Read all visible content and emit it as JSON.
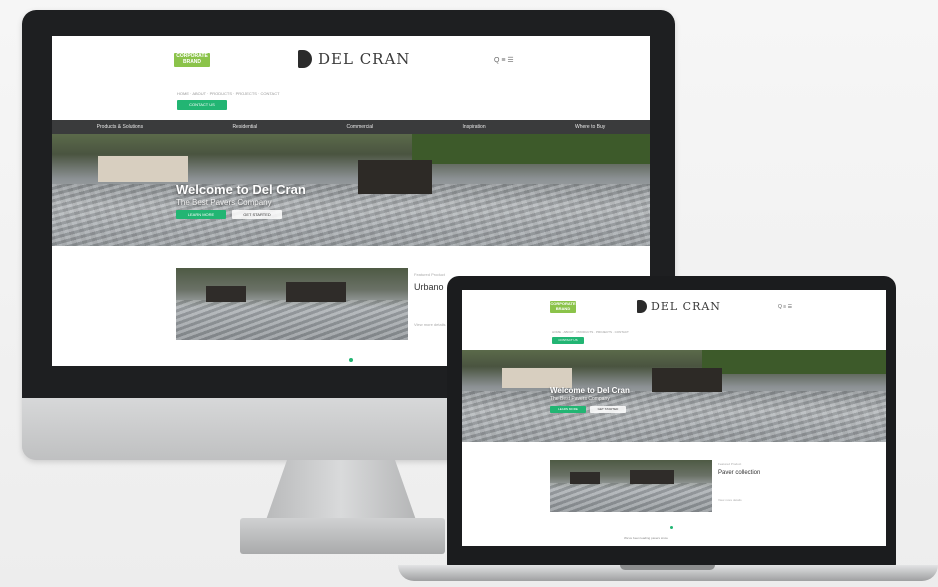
{
  "site": {
    "badge_line1": "CORPORATE",
    "badge_line2": "BRAND",
    "brand_name": "DEL CRAN",
    "search_label": "Q  ≡  ☰",
    "nav_text": "HOME · ABOUT · PRODUCTS · PROJECTS · CONTACT",
    "green_button": "CONTACT US",
    "categories": [
      "Products & Solutions",
      "Residential",
      "Commercial",
      "Inspiration",
      "Where to Buy"
    ],
    "hero_title": "Welcome to Del Cran",
    "hero_subtitle": "The Best Pavers Company",
    "hero_primary": "LEARN MORE",
    "hero_secondary": "GET STARTED",
    "feature_kicker": "Featured Product",
    "feature_title": "Urbano",
    "feature_title_laptop": "Paver collection",
    "feature_link": "View more details",
    "footer_text": "We've been leading pavers since"
  },
  "colors": {
    "accent": "#22b573",
    "badge": "#8bc34a",
    "catbar": "#3a3b3c",
    "bezel": "#1e1f21"
  },
  "icons": [
    "brand-mark-icon",
    "search-icon",
    "menu-icon"
  ]
}
